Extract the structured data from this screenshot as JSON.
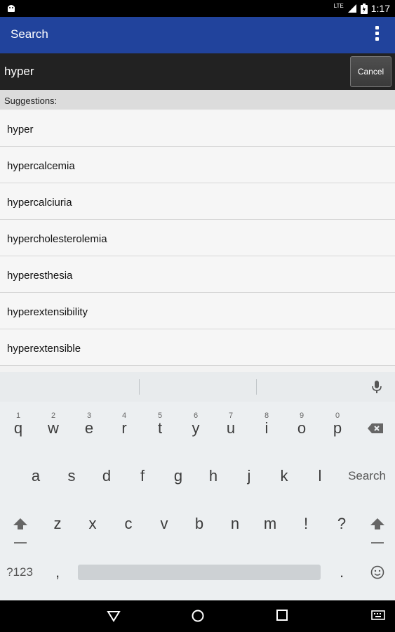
{
  "status_bar": {
    "network": "LTE",
    "time": "1:17"
  },
  "action_bar": {
    "title": "Search",
    "menu_icon": "overflow-menu-icon"
  },
  "search": {
    "query": "hyper",
    "cancel_label": "Cancel"
  },
  "suggestions": {
    "header": "Suggestions:",
    "items": [
      "hyper",
      "hypercalcemia",
      "hypercalciuria",
      "hypercholesterolemia",
      "hyperesthesia",
      "hyperextensibility",
      "hyperextensible"
    ]
  },
  "keyboard": {
    "row1": [
      "q",
      "w",
      "e",
      "r",
      "t",
      "y",
      "u",
      "i",
      "o",
      "p"
    ],
    "row1_hints": [
      "1",
      "2",
      "3",
      "4",
      "5",
      "6",
      "7",
      "8",
      "9",
      "0"
    ],
    "row2": [
      "a",
      "s",
      "d",
      "f",
      "g",
      "h",
      "j",
      "k",
      "l"
    ],
    "action_label": "Search",
    "row3": [
      "z",
      "x",
      "c",
      "v",
      "b",
      "n",
      "m",
      "!",
      "?"
    ],
    "symbols_label": "?123",
    "comma": ",",
    "period": "."
  },
  "colors": {
    "action_bar": "#21439c",
    "search_row": "#222222",
    "status_bar": "#000000"
  }
}
